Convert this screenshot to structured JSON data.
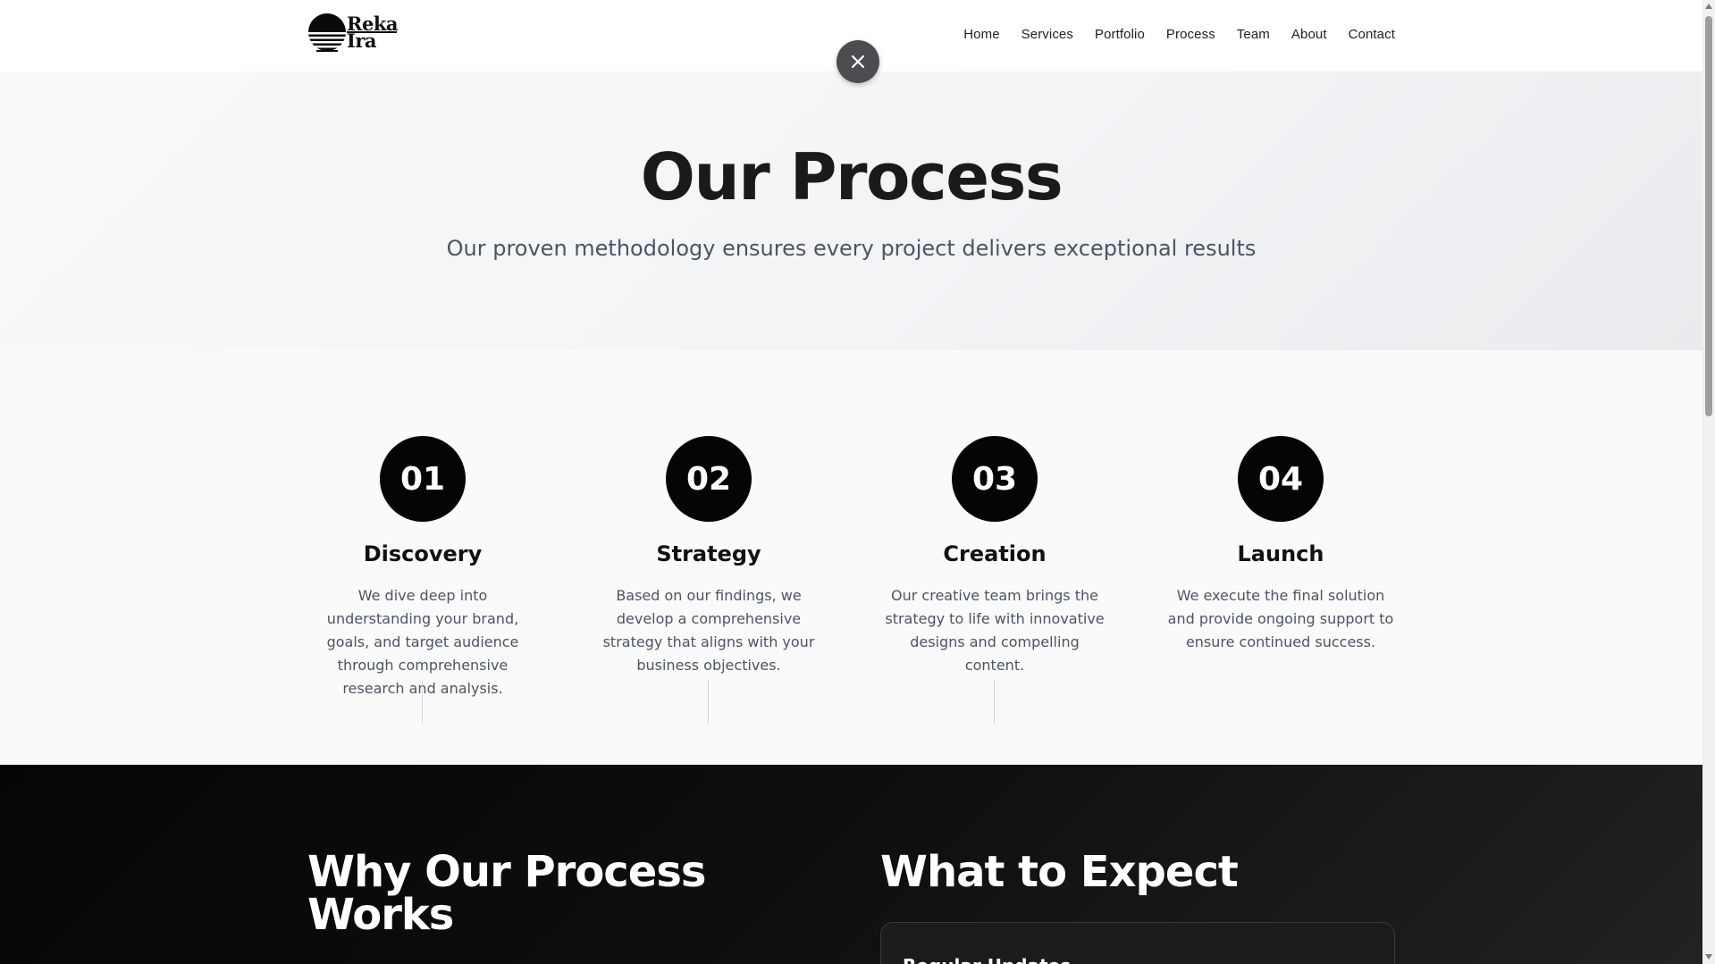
{
  "brand": {
    "line1": "Reka",
    "line2": "Ira"
  },
  "nav": {
    "items": [
      "Home",
      "Services",
      "Portfolio",
      "Process",
      "Team",
      "About",
      "Contact"
    ]
  },
  "close_icon": "close-icon",
  "hero": {
    "title": "Our Process",
    "subtitle": "Our proven methodology ensures every project delivers exceptional results"
  },
  "steps": [
    {
      "number": "01",
      "title": "Discovery",
      "description": "We dive deep into understanding your brand, goals, and target audience through comprehensive research and analysis."
    },
    {
      "number": "02",
      "title": "Strategy",
      "description": "Based on our findings, we develop a comprehensive strategy that aligns with your business objectives."
    },
    {
      "number": "03",
      "title": "Creation",
      "description": "Our creative team brings the strategy to life with innovative designs and compelling content."
    },
    {
      "number": "04",
      "title": "Launch",
      "description": "We execute the final solution and provide ongoing support to ensure continued success."
    }
  ],
  "why": {
    "title": "Why Our Process Works"
  },
  "expect": {
    "title": "What to Expect",
    "cards": [
      {
        "title": "Regular Updates"
      }
    ]
  },
  "colors": {
    "accent": "#050505",
    "close_button": "#4b4d50",
    "hero_bg": "#f3f4f6",
    "dark_bg": "#0f0f0f"
  }
}
